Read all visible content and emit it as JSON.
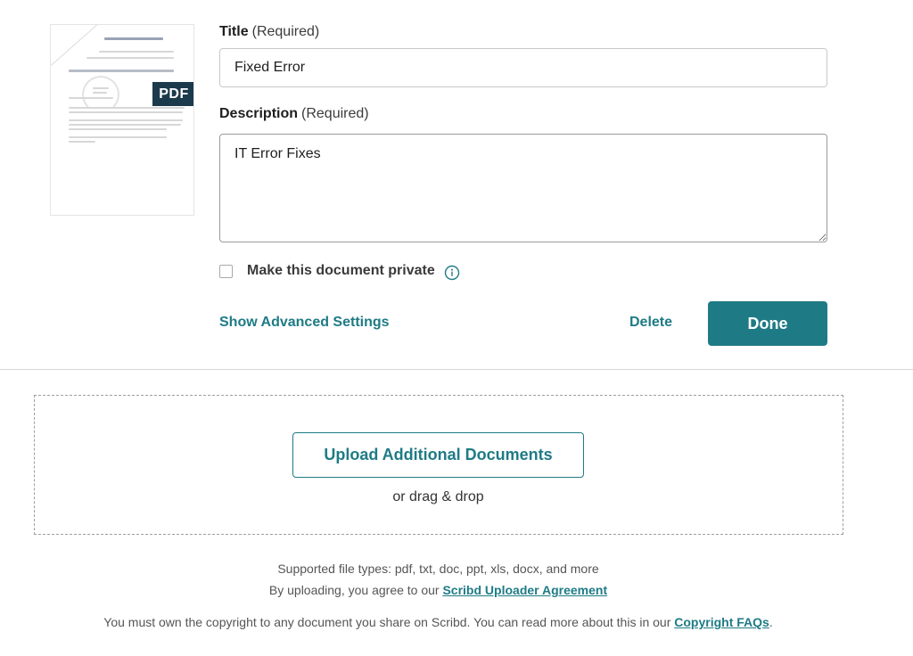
{
  "thumbnail": {
    "badge": "PDF",
    "fold_color": "#ffffff"
  },
  "form": {
    "title_label": "Title",
    "title_required": "(Required)",
    "title_value": "Fixed Error",
    "description_label": "Description",
    "description_required": "(Required)",
    "description_value": "IT Error Fixes",
    "private_label": "Make this document private",
    "private_checked": false,
    "advanced_settings": "Show Advanced Settings",
    "delete_label": "Delete",
    "done_label": "Done"
  },
  "upload": {
    "button_label": "Upload Additional Documents",
    "drag_text": "or drag & drop"
  },
  "footer": {
    "supported_types": "Supported file types: pdf, txt, doc, ppt, xls, docx, and more",
    "agree_prefix": "By uploading, you agree to our ",
    "agree_link": "Scribd Uploader Agreement",
    "copyright_prefix": "You must own the copyright to any document you share on Scribd. You can read more about this in our ",
    "copyright_link": "Copyright FAQs",
    "copyright_suffix": "."
  },
  "colors": {
    "accent": "#1e7b85",
    "badge_bg": "#1b3a4b"
  },
  "icons": {
    "info": "info-icon",
    "checkbox": "checkbox-icon"
  }
}
